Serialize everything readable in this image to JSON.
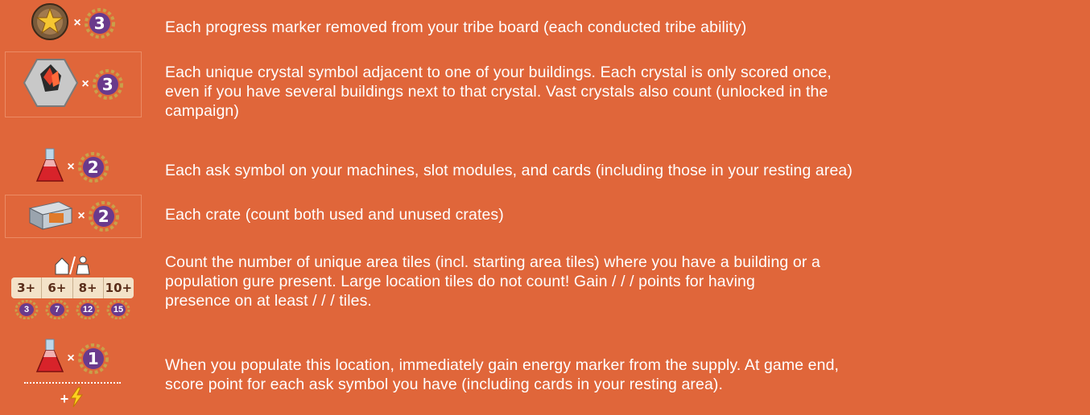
{
  "rows": [
    {
      "icon": "star-token-icon",
      "multiplier": "×",
      "points": "3",
      "lines": [
        "Each progress marker removed from your tribe board (each conducted tribe ability)"
      ]
    },
    {
      "icon": "crystal-tile-icon",
      "multiplier": "×",
      "points": "3",
      "lines": [
        "Each unique crystal symbol adjacent to one of your buildings. Each crystal is only scored once,",
        "even if you have several buildings next to that crystal. Vast crystals also count (unlocked in the",
        "campaign)"
      ]
    },
    {
      "icon": "flask-icon",
      "multiplier": "×",
      "points": "2",
      "lines": [
        "Each   ask symbol on your machines, slot modules, and cards (including those in your resting area)"
      ]
    },
    {
      "icon": "crate-icon",
      "multiplier": "×",
      "points": "2",
      "lines": [
        "Each crate (count both used and unused crates)"
      ]
    },
    {
      "icon": "building-population-icon",
      "tiers": [
        "3+",
        "6+",
        "8+",
        "10+"
      ],
      "tier_points": [
        "3",
        "7",
        "12",
        "15"
      ],
      "lines": [
        "Count the number of unique area tiles (incl. starting area tiles) where you have a building or a",
        "population   gure present. Large location tiles do not count! Gain   /   /     /       points for having",
        "presence on at least    /   /   /       tiles."
      ]
    },
    {
      "icon": "flask-icon",
      "multiplier": "×",
      "points": "1",
      "bonus": "+",
      "bonus_icon": "lightning-icon",
      "lines": [
        "When you populate this location, immediately gain    energy marker from the supply. At game end,",
        "score    point for each   ask symbol you have (including cards in your resting area)."
      ]
    }
  ],
  "colors": {
    "background": "#e0663a",
    "laurel_purple": "#6a3a8c",
    "laurel_gold": "#c9a04a",
    "text": "#ffffff"
  }
}
